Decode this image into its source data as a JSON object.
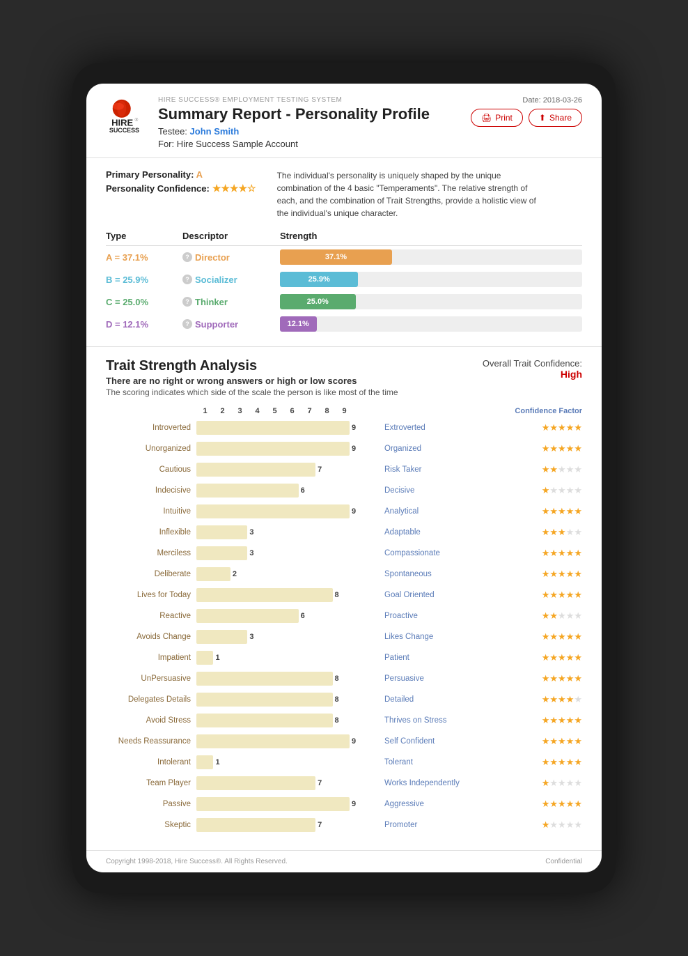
{
  "device": {
    "type": "tablet"
  },
  "header": {
    "system_label": "HIRE SUCCESS® EMPLOYMENT TESTING SYSTEM",
    "title": "Summary Report - Personality Profile",
    "testee_label": "Testee:",
    "testee_name": "John Smith",
    "for_label": "For: Hire Success Sample Account",
    "date_label": "Date: 2018-03-26",
    "print_btn": "Print",
    "share_btn": "Share"
  },
  "personality": {
    "primary_label": "Primary Personality:",
    "primary_value": "A",
    "confidence_label": "Personality Confidence:",
    "confidence_stars": 4,
    "confidence_max": 5,
    "description": "The individual's personality is uniquely shaped by the unique combination of the 4 basic \"Temperaments\". The relative strength of each, and the combination of Trait Strengths, provide a holistic view of the individual's unique character.",
    "columns": [
      "Type",
      "Descriptor",
      "Strength"
    ],
    "types": [
      {
        "label": "A = 37.1%",
        "color": "a",
        "descriptor": "Director",
        "strength": 37.1,
        "bar_label": "37.1%"
      },
      {
        "label": "B = 25.9%",
        "color": "b",
        "descriptor": "Socializer",
        "strength": 25.9,
        "bar_label": "25.9%"
      },
      {
        "label": "C = 25.0%",
        "color": "c",
        "descriptor": "Thinker",
        "strength": 25.0,
        "bar_label": "25.0%"
      },
      {
        "label": "D = 12.1%",
        "color": "d",
        "descriptor": "Supporter",
        "strength": 12.1,
        "bar_label": "12.1%"
      }
    ]
  },
  "trait": {
    "title": "Trait Strength Analysis",
    "subtitle": "There are no right or wrong answers or high or low scores",
    "note": "The scoring indicates which side of the scale the person is like most of the time",
    "overall_confidence_label": "Overall Trait Confidence:",
    "overall_confidence_value": "High",
    "scale": [
      1,
      2,
      3,
      4,
      5,
      6,
      7,
      8,
      9
    ],
    "confidence_factor_label": "Confidence Factor",
    "rows": [
      {
        "left": "Introverted",
        "value": 9,
        "right": "Extroverted",
        "stars": 5
      },
      {
        "left": "Unorganized",
        "value": 9,
        "right": "Organized",
        "stars": 5
      },
      {
        "left": "Cautious",
        "value": 7,
        "right": "Risk Taker",
        "stars": 2
      },
      {
        "left": "Indecisive",
        "value": 6,
        "right": "Decisive",
        "stars": 1
      },
      {
        "left": "Intuitive",
        "value": 9,
        "right": "Analytical",
        "stars": 5
      },
      {
        "left": "Inflexible",
        "value": 3,
        "right": "Adaptable",
        "stars": 3
      },
      {
        "left": "Merciless",
        "value": 3,
        "right": "Compassionate",
        "stars": 5
      },
      {
        "left": "Deliberate",
        "value": 2,
        "right": "Spontaneous",
        "stars": 5
      },
      {
        "left": "Lives for Today",
        "value": 8,
        "right": "Goal Oriented",
        "stars": 5
      },
      {
        "left": "Reactive",
        "value": 6,
        "right": "Proactive",
        "stars": 2
      },
      {
        "left": "Avoids Change",
        "value": 3,
        "right": "Likes Change",
        "stars": 5
      },
      {
        "left": "Impatient",
        "value": 1,
        "right": "Patient",
        "stars": 5
      },
      {
        "left": "UnPersuasive",
        "value": 8,
        "right": "Persuasive",
        "stars": 5
      },
      {
        "left": "Delegates Details",
        "value": 8,
        "right": "Detailed",
        "stars": 4
      },
      {
        "left": "Avoid Stress",
        "value": 8,
        "right": "Thrives on Stress",
        "stars": 5
      },
      {
        "left": "Needs Reassurance",
        "value": 9,
        "right": "Self Confident",
        "stars": 5
      },
      {
        "left": "Intolerant",
        "value": 1,
        "right": "Tolerant",
        "stars": 5
      },
      {
        "left": "Team Player",
        "value": 7,
        "right": "Works Independently",
        "stars": 1
      },
      {
        "left": "Passive",
        "value": 9,
        "right": "Aggressive",
        "stars": 5
      },
      {
        "left": "Skeptic",
        "value": 7,
        "right": "Promoter",
        "stars": 1
      }
    ]
  },
  "footer": {
    "copyright": "Copyright 1998-2018, Hire Success®. All Rights Reserved.",
    "confidential": "Confidential"
  }
}
